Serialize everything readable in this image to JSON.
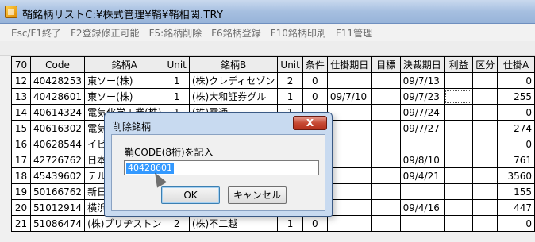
{
  "window": {
    "title": "鞘銘柄リストC:¥株式管理¥鞘¥鞘相関.TRY"
  },
  "menu": [
    "Esc/F1終了",
    "F2登録修正可能",
    "F5:銘柄削除",
    "F6銘柄登録",
    "F10銘柄印刷",
    "F11管理"
  ],
  "table": {
    "headers": [
      "70",
      "Code",
      "銘柄A",
      "Unit",
      "銘柄B",
      "Unit",
      "条件",
      "仕掛期日",
      "目標",
      "決裁期日",
      "利益",
      "区分",
      "仕掛A"
    ],
    "rows": [
      [
        "12",
        "40428253",
        "東ソー(株)",
        "1",
        "(株)クレディセゾン",
        "2",
        "0",
        "",
        "",
        "09/7/13",
        "",
        "",
        "0"
      ],
      [
        "13",
        "40428601",
        "東ソー(株)",
        "1",
        "(株)大和証券グル",
        "1",
        "0",
        "09/7/10",
        "",
        "09/7/23",
        "",
        "",
        "255"
      ],
      [
        "14",
        "40614324",
        "電気化学工業(株)",
        "1",
        "(株)電通",
        "1",
        "",
        "",
        "",
        "09/7/24",
        "",
        "",
        "0"
      ],
      [
        "15",
        "40616302",
        "電気化",
        "",
        "",
        "",
        "",
        "",
        "",
        "09/7/27",
        "",
        "",
        "274"
      ],
      [
        "16",
        "40628544",
        "イビデン",
        "",
        "",
        "",
        "",
        "",
        "",
        "",
        "",
        "",
        "0"
      ],
      [
        "17",
        "42726762",
        "日本化",
        "",
        "",
        "",
        "",
        "",
        "",
        "09/8/10",
        "",
        "",
        "761"
      ],
      [
        "18",
        "45439602",
        "テルモ",
        "",
        "",
        "",
        "",
        "",
        "",
        "09/4/21",
        "",
        "",
        "3560"
      ],
      [
        "19",
        "50166762",
        "新日鉄",
        "",
        "",
        "",
        "",
        "",
        "",
        "",
        "",
        "",
        "155"
      ],
      [
        "20",
        "51012914",
        "横浜ゴム",
        "",
        "",
        "",
        "",
        "",
        "",
        "09/4/16",
        "",
        "",
        "447"
      ],
      [
        "21",
        "51086474",
        "(株)ブリヂストン",
        "2",
        "(株)不二越",
        "1",
        "0",
        "",
        "",
        "",
        "",
        "",
        "0"
      ]
    ]
  },
  "dialog": {
    "title": "削除銘柄",
    "close_label": "X",
    "prompt": "鞘CODE(8桁)を記入",
    "input_value": "40428601",
    "ok_label": "OK",
    "cancel_label": "キャンセル"
  }
}
